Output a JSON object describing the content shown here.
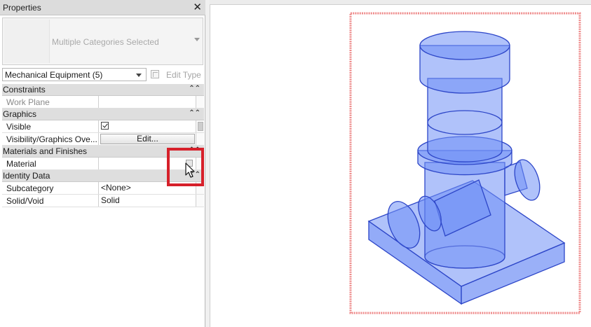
{
  "panel": {
    "title": "Properties",
    "close_glyph": "✕",
    "type_selector": {
      "name": "Multiple Categories Selected"
    },
    "filter": {
      "value": "Mechanical Equipment (5)"
    },
    "edit_type_label": "Edit Type",
    "sections": [
      {
        "label": "Constraints",
        "collapse": "⌃⌃",
        "rows": [
          {
            "name": "Work Plane",
            "value": ""
          }
        ]
      },
      {
        "label": "Graphics",
        "collapse": "⌃⌃",
        "rows": [
          {
            "name": "Visible",
            "value": ""
          },
          {
            "name": "Visibility/Graphics Ove...",
            "value": "Edit..."
          }
        ]
      },
      {
        "label": "Materials and Finishes",
        "collapse": "⌃⌃",
        "rows": [
          {
            "name": "Material",
            "value": ""
          }
        ]
      },
      {
        "label": "Identity Data",
        "collapse": "⌃⌃",
        "rows": [
          {
            "name": "Subcategory",
            "value": "<None>"
          },
          {
            "name": "Solid/Void",
            "value": "Solid"
          }
        ]
      }
    ]
  },
  "colors": {
    "highlight": "#d6202a",
    "model_fill": "#6f8ff5",
    "model_stroke": "#2d46c8",
    "selection_box": "#ee8b8b"
  },
  "icons": {
    "close": "close-icon",
    "collapse": "collapse-chevrons-icon",
    "edit_type": "edit-type-icon",
    "cursor": "mouse-pointer-icon"
  }
}
